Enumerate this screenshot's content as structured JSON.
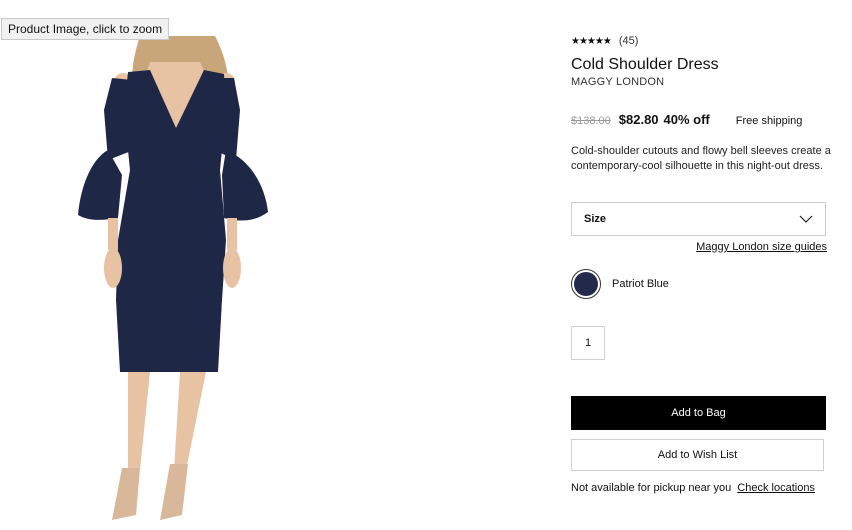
{
  "image": {
    "tooltip": "Product Image, click to zoom",
    "dress_color": "#1f2747"
  },
  "product": {
    "stars": "★★★★★",
    "rating_count": "(45)",
    "title": "Cold Shoulder Dress",
    "brand": "MAGGY LONDON",
    "original_price": "$138.00",
    "sale_price": "$82.80",
    "discount": "40% off",
    "shipping": "Free shipping",
    "description": "Cold-shoulder cutouts and flowy bell sleeves create a contemporary-cool silhouette in this night-out dress."
  },
  "size": {
    "label": "Size",
    "guide_link": "Maggy London size guides"
  },
  "color": {
    "name": "Patriot Blue",
    "swatch": "#22294a"
  },
  "quantity": "1",
  "actions": {
    "add_to_bag": "Add to Bag",
    "add_to_wish_list": "Add to Wish List"
  },
  "pickup": {
    "text": "Not available for pickup near you",
    "link": "Check locations"
  }
}
